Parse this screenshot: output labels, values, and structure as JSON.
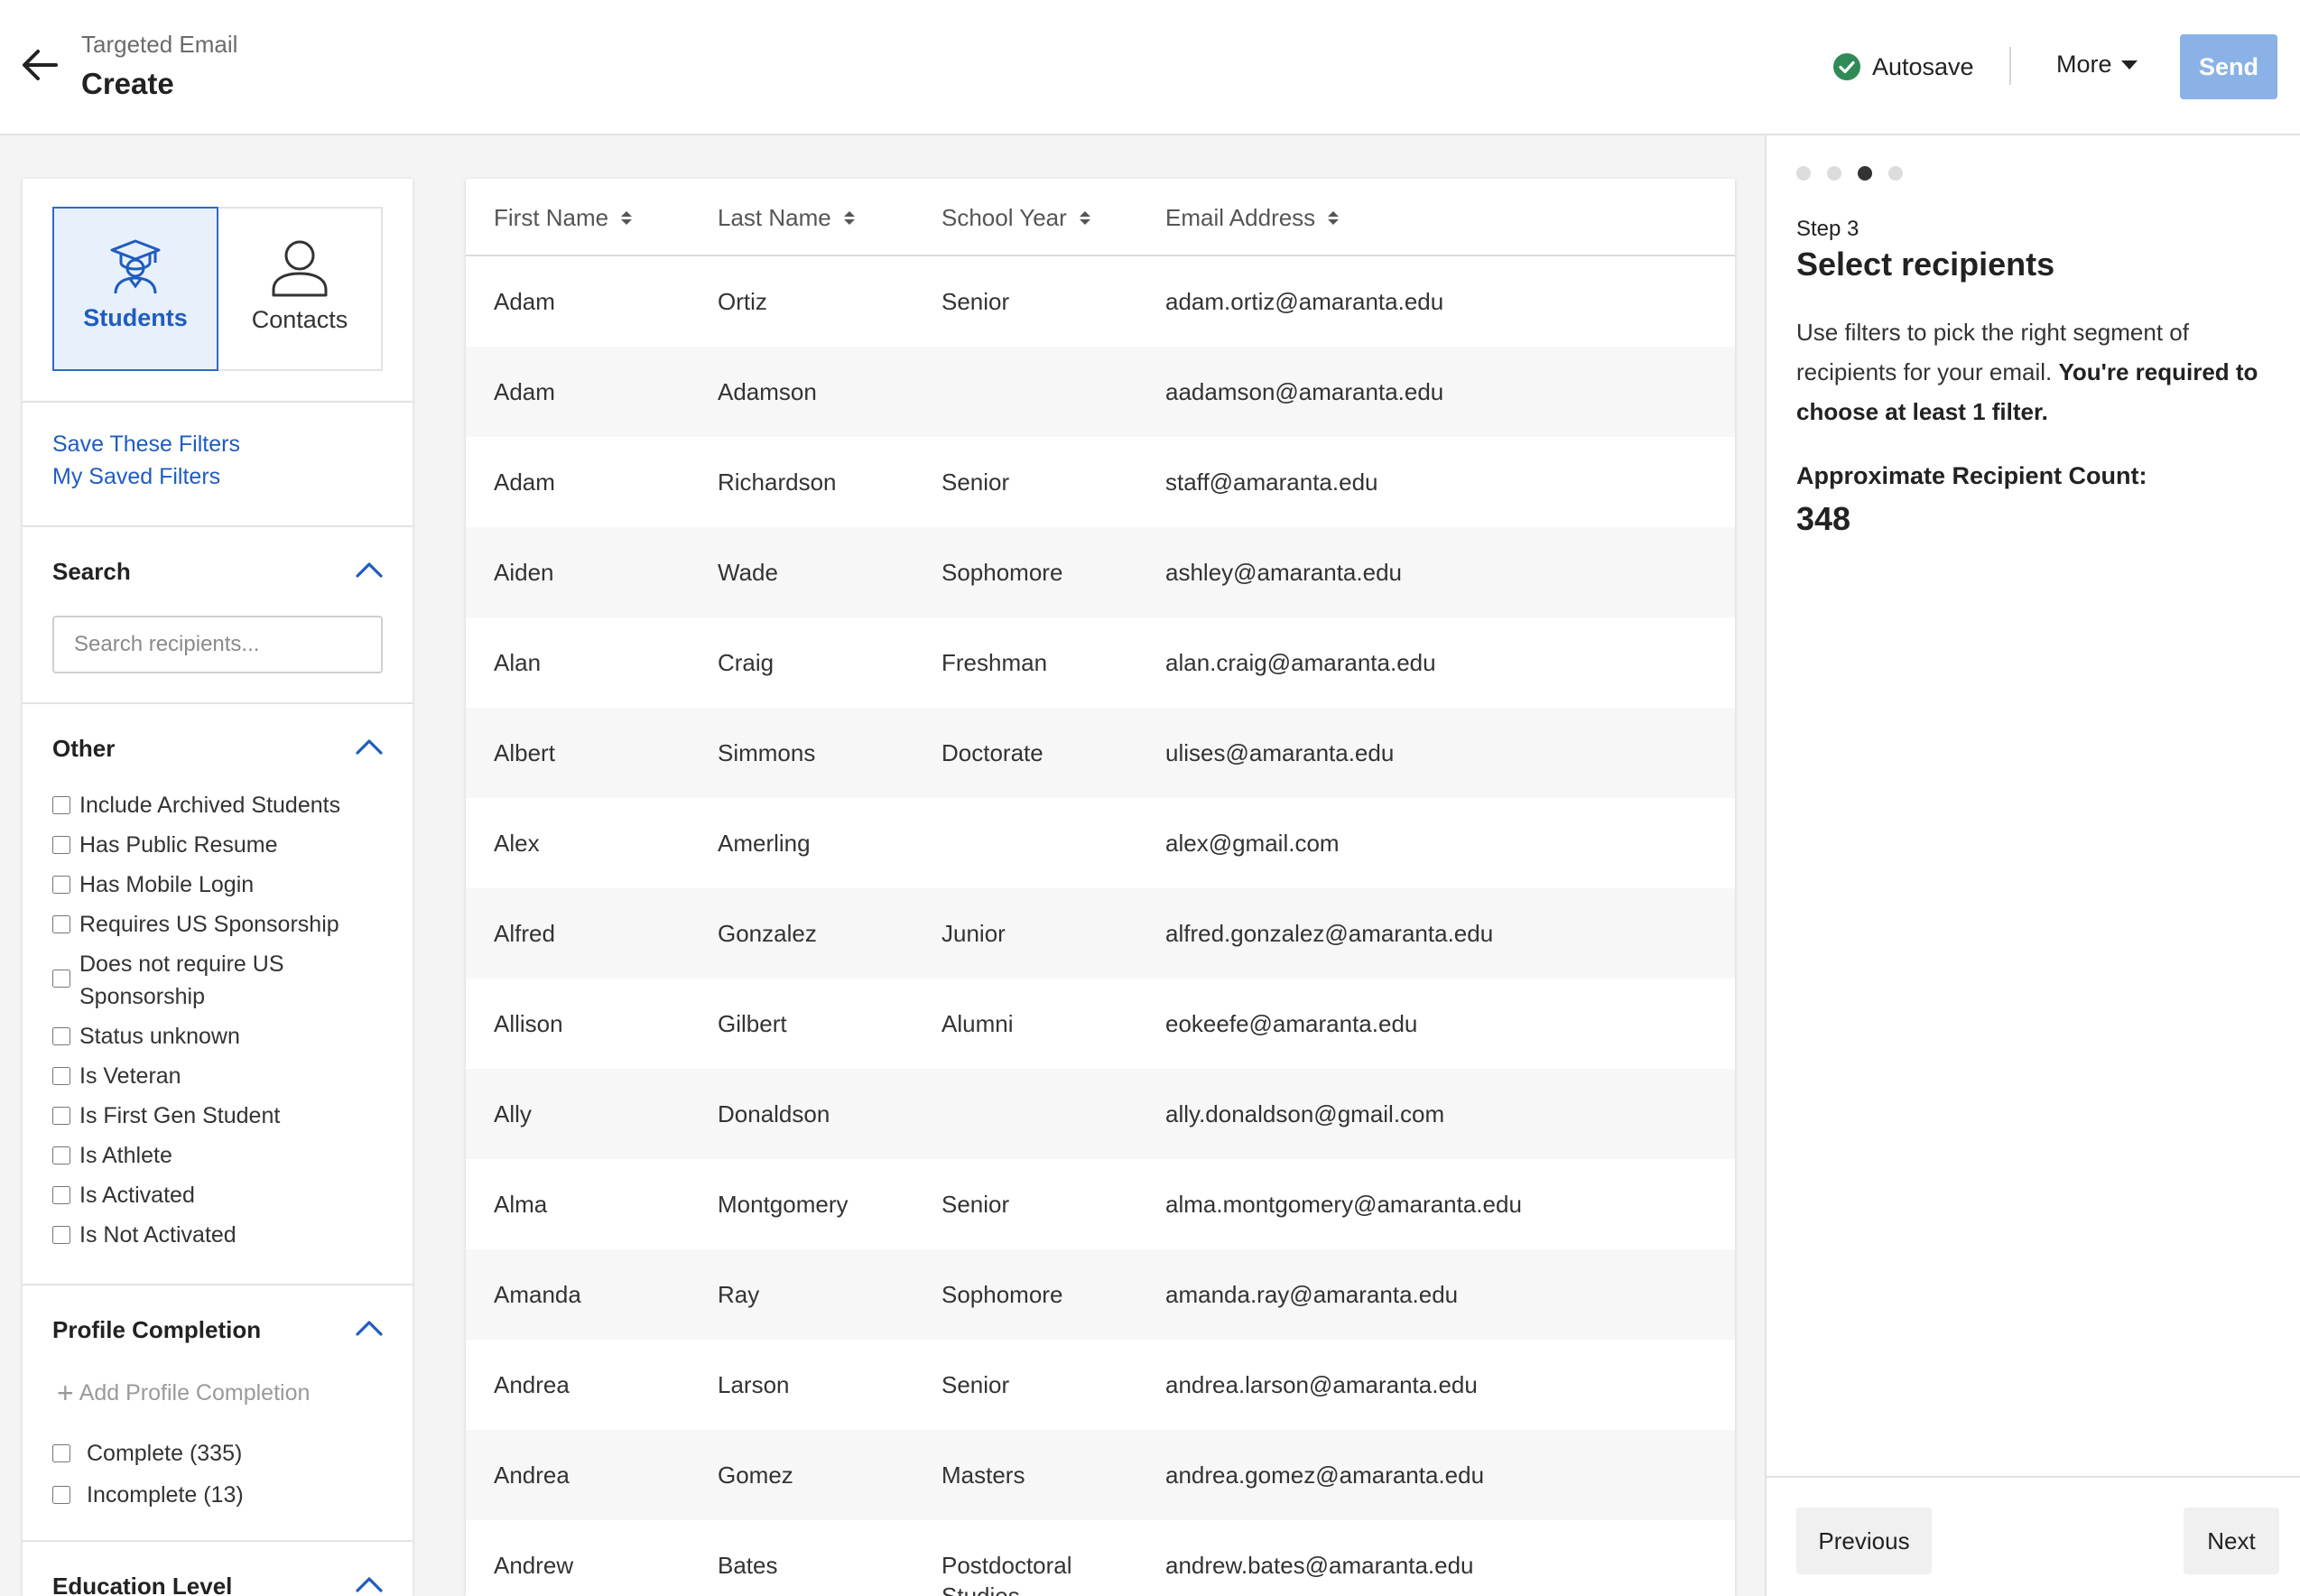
{
  "header": {
    "breadcrumb": "Targeted Email",
    "title": "Create",
    "autosave_label": "Autosave",
    "more_label": "More",
    "send_label": "Send"
  },
  "left": {
    "tabs": [
      {
        "label": "Students",
        "icon": "graduate-icon",
        "active": true
      },
      {
        "label": "Contacts",
        "icon": "person-icon",
        "active": false
      }
    ],
    "save_filters_label": "Save These Filters",
    "saved_filters_label": "My Saved Filters",
    "search": {
      "title": "Search",
      "placeholder": "Search recipients..."
    },
    "other": {
      "title": "Other",
      "options": [
        "Include Archived Students",
        "Has Public Resume",
        "Has Mobile Login",
        "Requires US Sponsorship",
        "Does not require US Sponsorship",
        "Status unknown",
        "Is Veteran",
        "Is First Gen Student",
        "Is Athlete",
        "Is Activated",
        "Is Not Activated"
      ]
    },
    "profile_completion": {
      "title": "Profile Completion",
      "add_label": "Add Profile Completion",
      "options": [
        "Complete (335)",
        "Incomplete (13)"
      ]
    },
    "education_level": {
      "title": "Education Level"
    }
  },
  "table": {
    "columns": [
      "First Name",
      "Last Name",
      "School Year",
      "Email Address"
    ],
    "rows": [
      [
        "Adam",
        "Ortiz",
        "Senior",
        "adam.ortiz@amaranta.edu"
      ],
      [
        "Adam",
        "Adamson",
        "",
        "aadamson@amaranta.edu"
      ],
      [
        "Adam",
        "Richardson",
        "Senior",
        "staff@amaranta.edu"
      ],
      [
        "Aiden",
        "Wade",
        "Sophomore",
        "ashley@amaranta.edu"
      ],
      [
        "Alan",
        "Craig",
        "Freshman",
        "alan.craig@amaranta.edu"
      ],
      [
        "Albert",
        "Simmons",
        "Doctorate",
        "ulises@amaranta.edu"
      ],
      [
        "Alex",
        "Amerling",
        "",
        "alex@gmail.com"
      ],
      [
        "Alfred",
        "Gonzalez",
        "Junior",
        "alfred.gonzalez@amaranta.edu"
      ],
      [
        "Allison",
        "Gilbert",
        "Alumni",
        "eokeefe@amaranta.edu"
      ],
      [
        "Ally",
        "Donaldson",
        "",
        "ally.donaldson@gmail.com"
      ],
      [
        "Alma",
        "Montgomery",
        "Senior",
        "alma.montgomery@amaranta.edu"
      ],
      [
        "Amanda",
        "Ray",
        "Sophomore",
        "amanda.ray@amaranta.edu"
      ],
      [
        "Andrea",
        "Larson",
        "Senior",
        "andrea.larson@amaranta.edu"
      ],
      [
        "Andrea",
        "Gomez",
        "Masters",
        "andrea.gomez@amaranta.edu"
      ],
      [
        "Andrew",
        "Bates",
        "Postdoctoral Studies",
        "andrew.bates@amaranta.edu"
      ]
    ]
  },
  "right": {
    "step_label": "Step 3",
    "title": "Select recipients",
    "description": "Use filters to pick the right segment of recipients for your email.",
    "description_bold": "You're required to choose at least 1 filter.",
    "count_label": "Approximate Recipient Count:",
    "count_value": "348",
    "current_step": 3,
    "total_steps": 4,
    "previous_label": "Previous",
    "next_label": "Next"
  },
  "colors": {
    "accent": "#1f5cbf",
    "send_button": "#8ab2e6",
    "autosave_check": "#2e8b57"
  }
}
